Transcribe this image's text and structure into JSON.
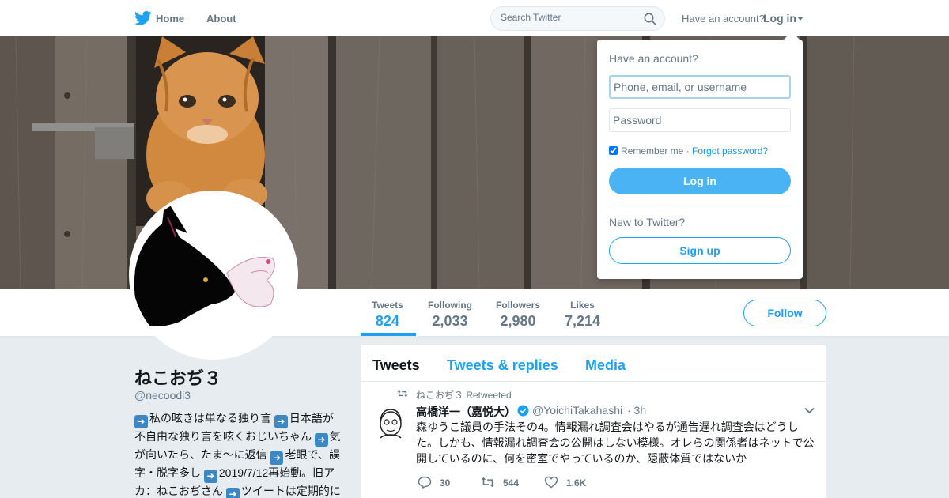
{
  "nav": {
    "home_label": "Home",
    "about_label": "About",
    "search_placeholder": "Search Twitter",
    "have_account": "Have an account?",
    "login_label": "Log in",
    "brand_color": "#1da1f2"
  },
  "profile": {
    "name": "ねこおぢ３",
    "handle": "@necoodi3",
    "bio_segments": [
      "私の呟きは単なる独り言",
      "日本語が不自由な独り言を呟くおじいちゃん",
      "気が向いたら、たま～に返信",
      "老眼で、誤字・脱字多し",
      "2019/7/12再始動。旧アカ：ねこおぢさん",
      "ツイートは定期的に削除"
    ],
    "follow_label": "Follow"
  },
  "stats": [
    {
      "label": "Tweets",
      "value": "824"
    },
    {
      "label": "Following",
      "value": "2,033"
    },
    {
      "label": "Followers",
      "value": "2,980"
    },
    {
      "label": "Likes",
      "value": "7,214"
    }
  ],
  "timeline": {
    "tabs": [
      "Tweets",
      "Tweets & replies",
      "Media"
    ],
    "tweet": {
      "retweeted_by": "ねこおぢ３ Retweeted",
      "author_name": "高橋洋一（嘉悦大）",
      "author_handle": "@YoichiTakahashi",
      "time": "· 3h",
      "text": "森ゆうこ議員の手法その4。情報漏れ調査会はやるが通告遅れ調査会はどうした。しかも、情報漏れ調査会の公開はしない模様。オレらの関係者はネットで公開しているのに、何を密室でやっているのか、隠蔽体質ではないか",
      "replies": "30",
      "retweets": "544",
      "likes": "1.6K"
    }
  },
  "login_dropdown": {
    "title": "Have an account?",
    "username_placeholder": "Phone, email, or username",
    "password_placeholder": "Password",
    "remember_label": "Remember me",
    "separator": " · ",
    "forgot_label": "Forgot password?",
    "login_button": "Log in",
    "new_label": "New to Twitter?",
    "signup_button": "Sign up"
  }
}
